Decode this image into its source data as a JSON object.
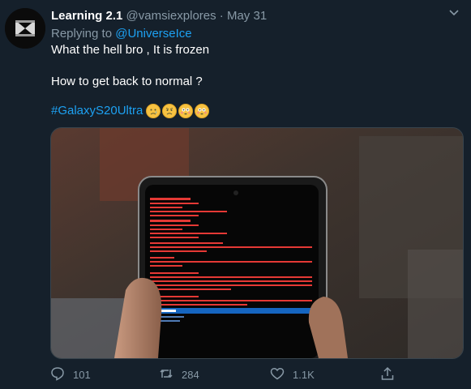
{
  "tweet": {
    "display_name": "Learning 2.1",
    "handle": "@vamsiexplores",
    "separator": "·",
    "date": "May 31",
    "replying_prefix": "Replying to",
    "replying_handle": "@UniverseIce",
    "line1": "What the hell bro , It is frozen",
    "line2": "How to get back to normal ?",
    "hashtag": "#GalaxyS20Ultra",
    "emojis": [
      "crying-face",
      "worried-face",
      "flushed-face",
      "flushed-face"
    ]
  },
  "photo": {
    "phone_screen_title": "Android Recovery",
    "selected_menu_item": "Try again"
  },
  "actions": {
    "reply_count": "101",
    "retweet_count": "284",
    "like_count": "1.1K"
  },
  "colors": {
    "background": "#15202b",
    "link": "#1da1f2",
    "muted": "#8899a6",
    "recovery_text": "#e53935",
    "highlight": "#1565c0"
  }
}
